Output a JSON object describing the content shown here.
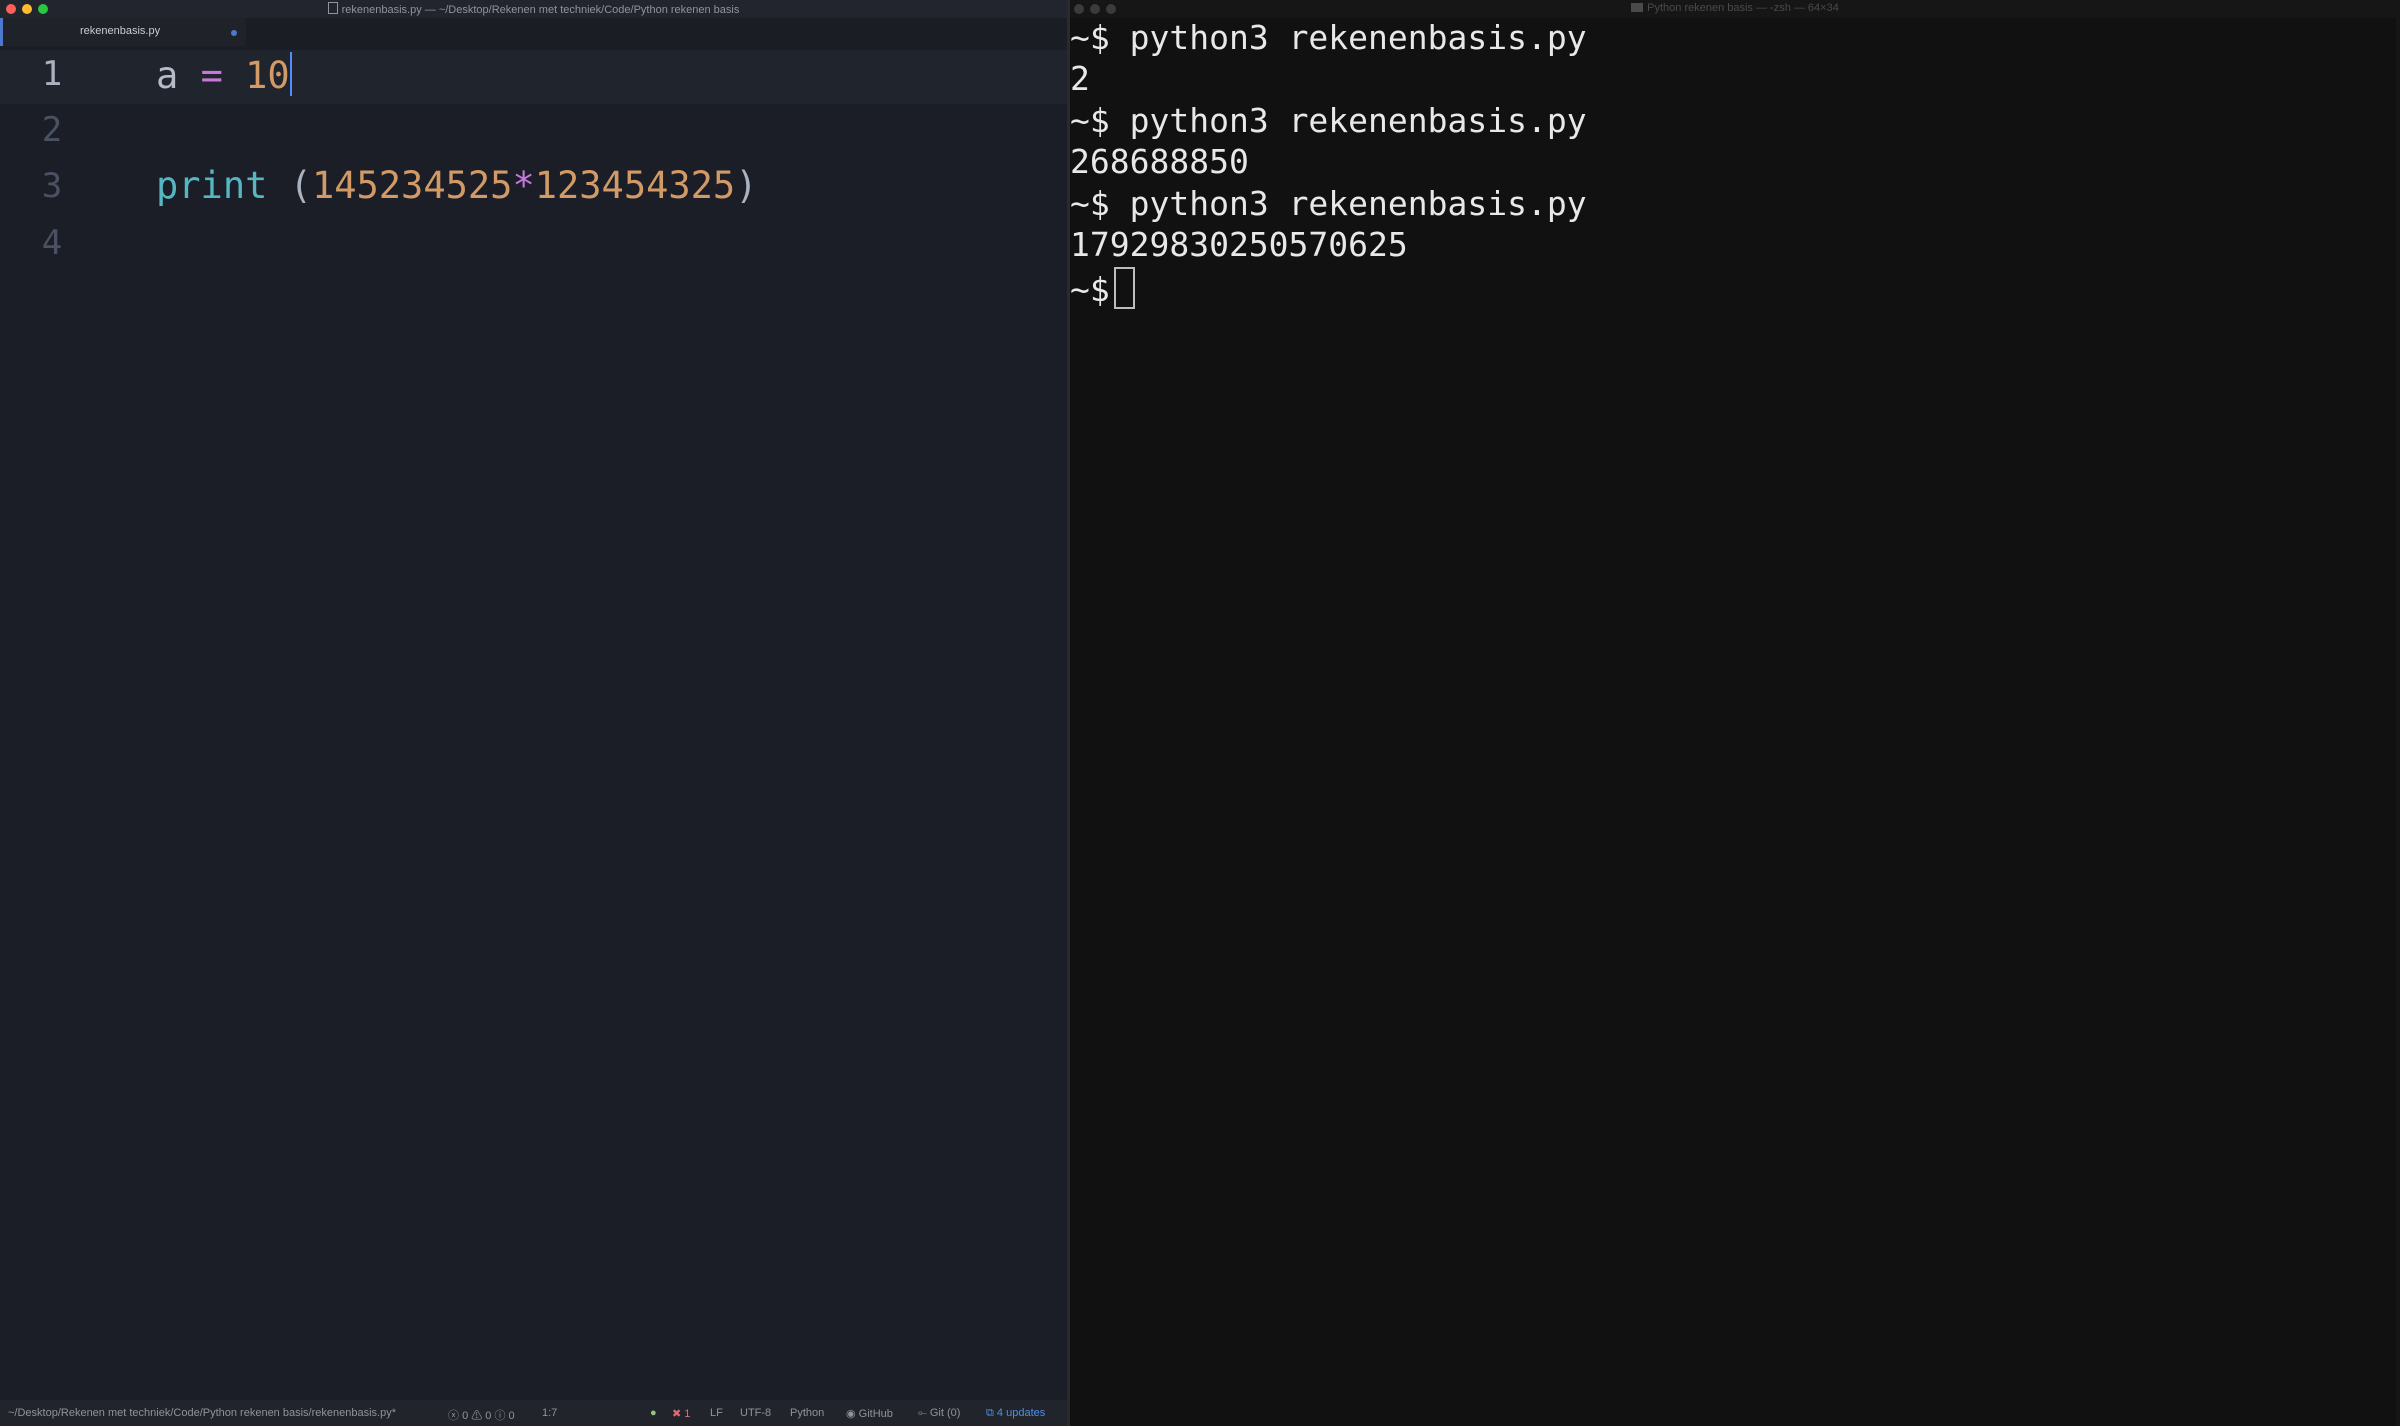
{
  "editor": {
    "window_title": "rekenenbasis.py — ~/Desktop/Rekenen met techniek/Code/Python rekenen basis",
    "tab_label": "rekenenbasis.py",
    "line_numbers": [
      "1",
      "2",
      "3",
      "4"
    ],
    "code": {
      "line1": {
        "var": "a",
        "op": "=",
        "num": "10"
      },
      "line3": {
        "fn": "print",
        "open": "(",
        "num1": "145234525",
        "op": "*",
        "num2": "123454325",
        "close": ")"
      }
    },
    "statusbar": {
      "path": "~/Desktop/Rekenen met techniek/Code/Python rekenen basis/rekenenbasis.py*",
      "diagnostics": "0 ⚠ 0 ⓘ 0",
      "cursor_pos": "1:7",
      "errors": "1",
      "line_ending": "LF",
      "encoding": "UTF-8",
      "grammar": "Python",
      "github": "GitHub",
      "git": "Git (0)",
      "updates": "4 updates"
    },
    "colors": {
      "background": "#1b1e26",
      "accent": "#4d78cc",
      "number": "#d19a66",
      "function": "#56b6c2",
      "operator": "#c678dd"
    }
  },
  "terminal": {
    "window_title": "Python rekenen basis — -zsh — 64×34",
    "prompt": "~$",
    "lines": [
      {
        "prompt": "~$",
        "text": "python3 rekenenbasis.py"
      },
      {
        "prompt": "",
        "text": "2"
      },
      {
        "prompt": "~$",
        "text": "python3 rekenenbasis.py"
      },
      {
        "prompt": "",
        "text": "268688850"
      },
      {
        "prompt": "~$",
        "text": "python3 rekenenbasis.py"
      },
      {
        "prompt": "",
        "text": "17929830250570625"
      }
    ],
    "colors": {
      "background": "#111111",
      "text": "#e8e8e8"
    }
  }
}
